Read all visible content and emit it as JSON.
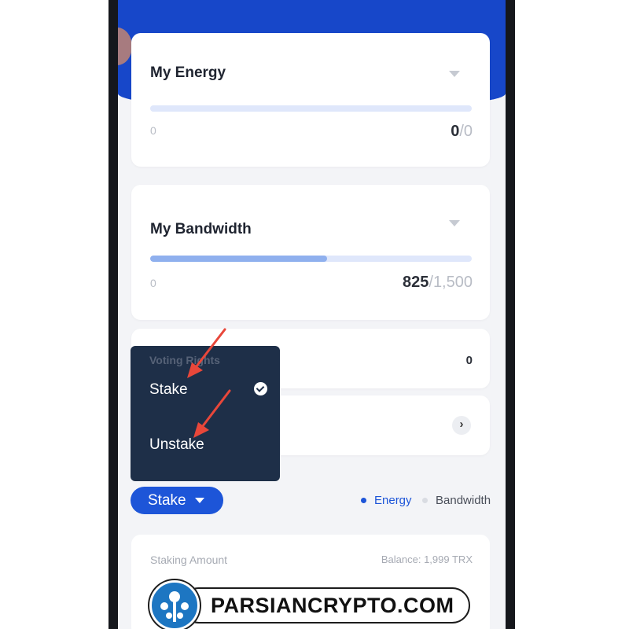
{
  "energy": {
    "title": "My Energy",
    "min": "0",
    "used": "0",
    "separator": "/",
    "total": "0",
    "fill_fraction": 0.0
  },
  "bandwidth": {
    "title": "My Bandwidth",
    "min": "0",
    "used": "825",
    "separator": "/",
    "total": "1,500",
    "fill_fraction": 0.55
  },
  "voting": {
    "label": "Voting Rights",
    "value": "0"
  },
  "dropdown": {
    "items": [
      {
        "label": "Stake",
        "selected": true
      },
      {
        "label": "Unstake",
        "selected": false
      }
    ]
  },
  "stake_button": {
    "label": "Stake"
  },
  "resource": {
    "options": [
      {
        "label": "Energy",
        "selected": true
      },
      {
        "label": "Bandwidth",
        "selected": false
      }
    ]
  },
  "staking": {
    "amount_label": "Staking Amount",
    "balance": "Balance: 1,999 TRX"
  },
  "watermark": {
    "text": "PARSIANCRYPTO.COM"
  },
  "colors": {
    "accent": "#1d55d8",
    "header": "#1747c9",
    "dropdown_bg": "#1e2f48",
    "arrow": "#e8473a"
  }
}
